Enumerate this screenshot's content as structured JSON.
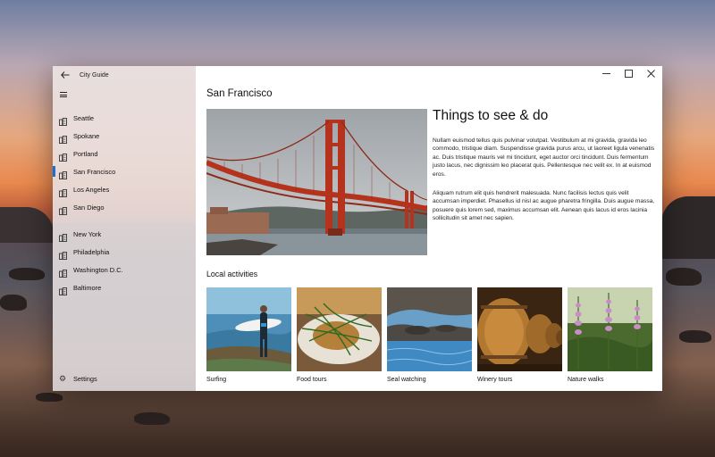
{
  "app": {
    "title": "City Guide"
  },
  "window_controls": {
    "minimize": "—",
    "maximize": "☐",
    "close": "✕"
  },
  "nav": {
    "items": [
      {
        "label": "Seattle",
        "selected": false
      },
      {
        "label": "Spokane",
        "selected": false
      },
      {
        "label": "Portland",
        "selected": false
      },
      {
        "label": "San Francisco",
        "selected": true
      },
      {
        "label": "Los Angeles",
        "selected": false
      },
      {
        "label": "San Diego",
        "selected": false
      },
      {
        "label": "New York",
        "selected": false
      },
      {
        "label": "Philadelphia",
        "selected": false
      },
      {
        "label": "Washington D.C.",
        "selected": false
      },
      {
        "label": "Baltimore",
        "selected": false
      }
    ],
    "settings_label": "Settings",
    "accent": "#1d6fd6"
  },
  "page": {
    "title": "San Francisco",
    "section_title": "Things to see & do",
    "paragraph1": "Nullam euismod tellus quis pulvinar volutpat. Vestibulum at mi gravida, gravida leo commodo, tristique diam. Suspendisse gravida purus arcu, ut laoreet ligula venenatis ac. Duis tristique mauris vel mi tincidunt, eget auctor orci tincidunt. Duis fermentum justo lacus, nec dignissim leo placerat quis. Pellentesque nec velit ex. In at euismod eros.",
    "paragraph2": "Aliquam rutrum elit quis hendrerit malesuada. Nunc facilisis lectus quis velit accumsan imperdiet. Phasellus id nisl ac augue pharetra fringilla. Duis augue massa, posuere quis lorem sed, maximus accumsan elit. Aenean quis lacus id eros lacinia sollicitudin sit amet nec sapien.",
    "activities_title": "Local activities",
    "activities": [
      {
        "label": "Surfing"
      },
      {
        "label": "Food tours"
      },
      {
        "label": "Seal watching"
      },
      {
        "label": "Winery tours"
      },
      {
        "label": "Nature walks"
      }
    ]
  }
}
